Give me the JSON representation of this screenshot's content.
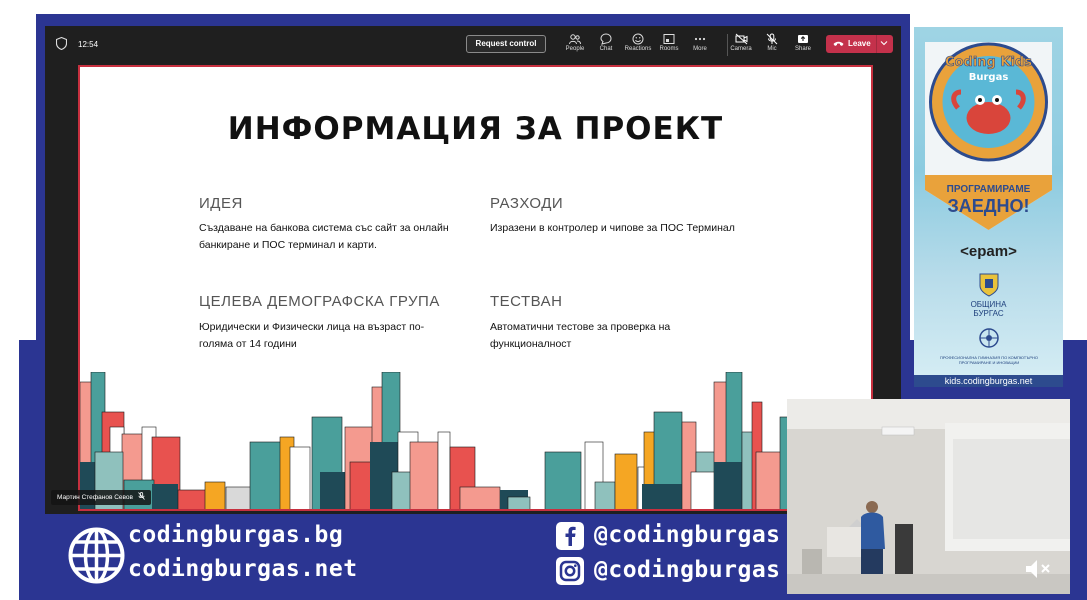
{
  "meeting": {
    "time": "12:54",
    "request_control": "Request control",
    "toolbar": [
      {
        "id": "people",
        "label": "People",
        "icon": "people-icon"
      },
      {
        "id": "chat",
        "label": "Chat",
        "icon": "chat-icon"
      },
      {
        "id": "reactions",
        "label": "Reactions",
        "icon": "reactions-icon"
      },
      {
        "id": "rooms",
        "label": "Rooms",
        "icon": "rooms-icon"
      },
      {
        "id": "more",
        "label": "More",
        "icon": "more-icon"
      },
      {
        "id": "camera",
        "label": "Camera",
        "icon": "camera-icon"
      },
      {
        "id": "mic",
        "label": "Mic",
        "icon": "mic-icon"
      },
      {
        "id": "share",
        "label": "Share",
        "icon": "share-icon"
      }
    ],
    "leave": "Leave",
    "presenter_name": "Мартин Стефанов Севов",
    "leave_color": "#c4314b"
  },
  "slide": {
    "title": "ИНФОРМАЦИЯ ЗА ПРОЕКТ",
    "sections": {
      "idea": {
        "heading": "ИДЕЯ",
        "body": "Създаване на банкова система със сайт за онлайн банкиране и ПОС терминал и карти."
      },
      "costs": {
        "heading": "РАЗХОДИ",
        "body": "Изразени в контролер и чипове за ПОС Терминал"
      },
      "demo": {
        "heading": "ЦЕЛЕВА ДЕМОГРАФСКА ГРУПА",
        "body": "Юридически и Физически лица на възраст по-голяма от 14 години"
      },
      "tested": {
        "heading": "ТЕСТВАН",
        "body": "Автоматични тестове за проверка на функционалност"
      }
    },
    "skyline_colors": [
      "#4a9f9b",
      "#e8524f",
      "#f49a8f",
      "#f5a623",
      "#1f4a57",
      "#ffffff",
      "#8fc1bd",
      "#d9d9d9"
    ]
  },
  "banner": {
    "logo_top": "Coding Kids",
    "logo_city": "Burgas",
    "slogan_1": "ПРОГРАМИРАМЕ",
    "slogan_2": "ЗАЕДНО!",
    "sponsor": "<epam>",
    "municipality_1": "ОБЩИНА",
    "municipality_2": "БУРГАС",
    "profile_school": "ПРОФЕСИОНАЛНА ГИМНАЗИЯ ПО КОМПЮТЪРНО ПРОГРАМИРАНЕ И ИНОВАЦИИ",
    "url": "kids.codingburgas.net"
  },
  "footer": {
    "url1": "codingburgas.bg",
    "url2": "codingburgas.net",
    "facebook": "@codingburgas",
    "instagram": "@codingburgas",
    "brand_blue": "#2b3592"
  }
}
